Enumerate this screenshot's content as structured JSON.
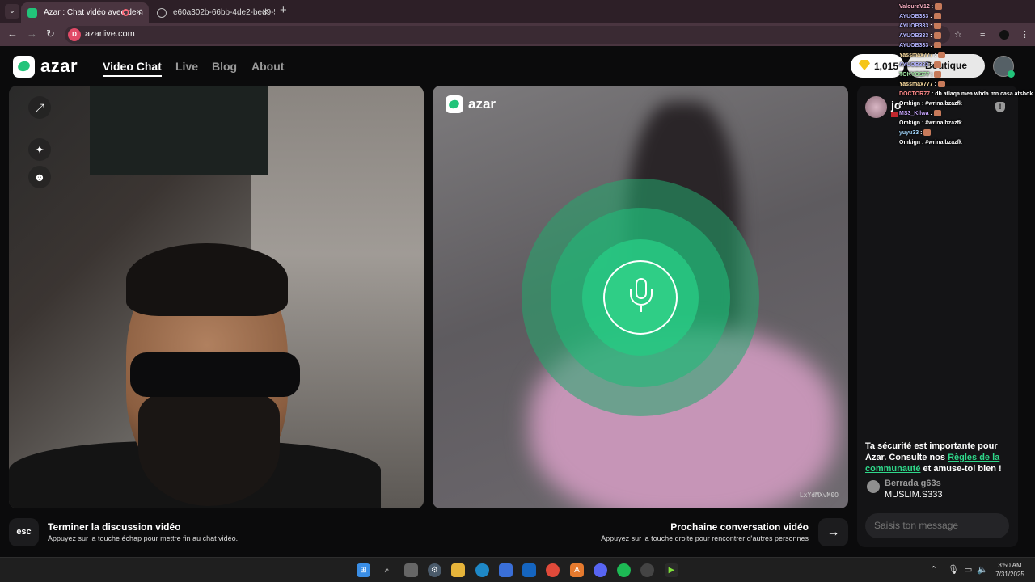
{
  "browser": {
    "tabs": [
      {
        "title": "Azar : Chat vidéo avec de n",
        "active": true
      },
      {
        "title": "e60a302b-66bb-4de2-bed9-5b",
        "active": false
      }
    ],
    "new_tab": "+",
    "url": "azarlive.com",
    "site_icon_text": "D"
  },
  "header": {
    "logo": "azar",
    "nav": [
      {
        "label": "Video Chat",
        "active": true
      },
      {
        "label": "Live",
        "active": false
      },
      {
        "label": "Blog",
        "active": false
      },
      {
        "label": "About",
        "active": false
      }
    ],
    "gems": "1,015",
    "shop_label": "Boutique"
  },
  "peer": {
    "logo": "azar",
    "watermark": "LxYdMXvM0O"
  },
  "sidebar": {
    "partner_name": "jo",
    "safety_prefix": "Ta sécurité est importante pour Azar. Consulte nos ",
    "safety_link": "Règles de la communauté",
    "safety_suffix": " et amuse-toi bien !",
    "message": {
      "name": "Berrada g63s",
      "text": "MUSLIM.S333"
    },
    "input_placeholder": "Saisis ton message"
  },
  "actions": {
    "esc_key": "esc",
    "end_title": "Terminer la discussion vidéo",
    "end_sub": "Appuyez sur la touche échap pour mettre fin au chat vidéo.",
    "next_title": "Prochaine conversation vidéo",
    "next_sub": "Appuyez sur la touche droite pour rencontrer d'autres personnes",
    "next_arrow": "→"
  },
  "overlay_chat": [
    {
      "user": "ValouraV12",
      "msg": "",
      "color": "#ffb3c7"
    },
    {
      "user": "AYUOB333",
      "msg": "",
      "color": "#b3b3ff"
    },
    {
      "user": "AYUOB333",
      "msg": "",
      "color": "#b3b3ff"
    },
    {
      "user": "AYUOB333",
      "msg": "",
      "color": "#b3b3ff"
    },
    {
      "user": "AYUOB333",
      "msg": "",
      "color": "#b3b3ff"
    },
    {
      "user": "Yassmax777",
      "msg": "",
      "color": "#ffe0a3"
    },
    {
      "user": "AYUOB333",
      "msg": "",
      "color": "#b3b3ff"
    },
    {
      "user": "TOKYOS77",
      "msg": "",
      "color": "#9fe6a0"
    },
    {
      "user": "Yassmax777",
      "msg": "",
      "color": "#ffe0a3"
    },
    {
      "user": "DOCTOR77",
      "msg": "db atlaqa mea whda mn casa atsbok",
      "color": "#ff8a8a"
    },
    {
      "user": "Omkign",
      "msg": "#wrina bzazfk",
      "color": "#ffffff"
    },
    {
      "user": "MS3_Kilwa",
      "msg": "",
      "color": "#c9a6ff"
    },
    {
      "user": "Omkign",
      "msg": "#wrina bzazfk",
      "color": "#ffffff"
    },
    {
      "user": "yuyu33",
      "msg": "",
      "color": "#a3d8ff"
    },
    {
      "user": "Omkign",
      "msg": "#wrina bzazfk",
      "color": "#ffffff"
    }
  ],
  "taskbar": {
    "time": "3:50 AM",
    "date": "7/31/2025"
  },
  "colors": {
    "accent": "#2fce86",
    "link": "#2fd88a",
    "background": "#0b0b0c"
  }
}
